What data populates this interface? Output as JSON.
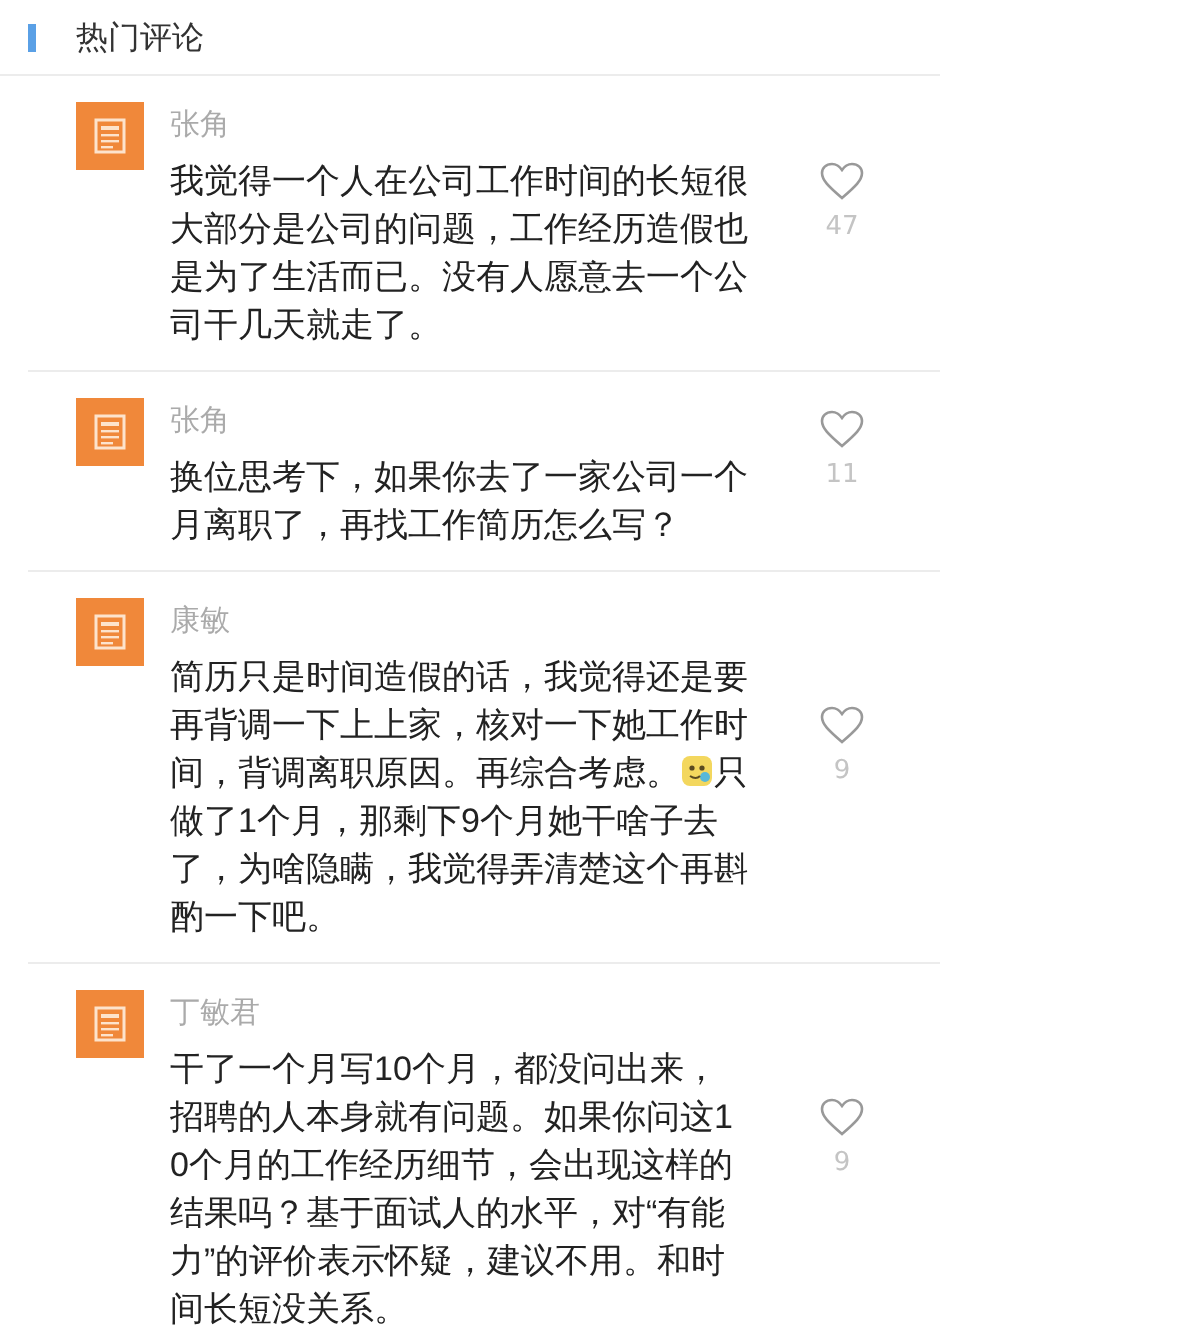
{
  "section_title": "热门评论",
  "comments": [
    {
      "author": "张角",
      "parts": [
        {
          "kind": "text",
          "text": "我觉得一个人在公司工作时间的长短很大部分是公司的问题，工作经历造假也是为了生活而已。没有人愿意去一个公司干几天就走了。"
        }
      ],
      "likes": "47"
    },
    {
      "author": "张角",
      "parts": [
        {
          "kind": "text",
          "text": "换位思考下，如果你去了一家公司一个月离职了，再找工作简历怎么写？"
        }
      ],
      "likes": "11"
    },
    {
      "author": "康敏",
      "parts": [
        {
          "kind": "text",
          "text": "简历只是时间造假的话，我觉得还是要再背调一下上上家，核对一下她工作时间，背调离职原因。再综合考虑。"
        },
        {
          "kind": "emoji"
        },
        {
          "kind": "text",
          "text": "只做了1个月，那剩下9个月她干啥子去了，为啥隐瞒，我觉得弄清楚这个再斟酌一下吧。"
        }
      ],
      "likes": "9"
    },
    {
      "author": "丁敏君",
      "parts": [
        {
          "kind": "text",
          "text": "干了一个月写10个月，都没问出来，招聘的人本身就有问题。如果你问这10个月的工作经历细节，会出现这样的结果吗？基于面试人的水平，对“有能力”的评价表示怀疑，建议不用。和时间长短没关系。"
        }
      ],
      "likes": "9"
    }
  ]
}
